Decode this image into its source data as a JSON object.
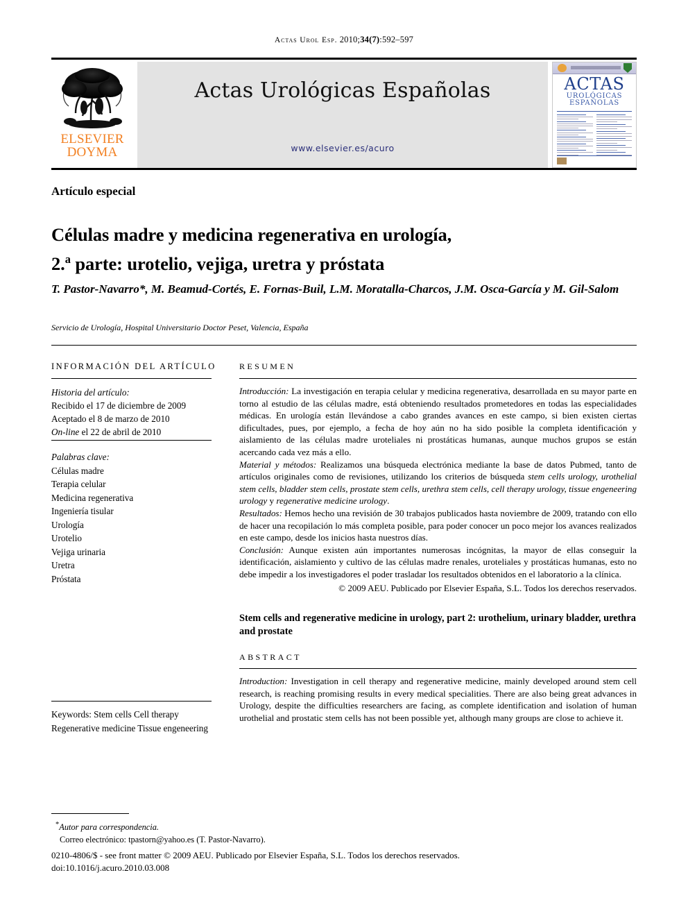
{
  "running_head": {
    "journal_abbrev": "Actas Urol Esp.",
    "citation": "2010;",
    "volume_issue": "34(7)",
    "pages": ":592–597"
  },
  "masthead": {
    "publisher_line1": "ELSEVIER",
    "publisher_line2": "DOYMA",
    "journal_title": "Actas Urológicas Españolas",
    "journal_url": "www.elsevier.es/acuro",
    "cover": {
      "title": "ACTAS",
      "subtitle_line1": "UROLÓGICAS",
      "subtitle_line2": "ESPAÑOLAS"
    }
  },
  "article": {
    "section_type": "Artículo especial",
    "title_line1": "Células madre y medicina regenerativa en urología,",
    "title_line2_prefix": "2.",
    "title_line2_sup": "a",
    "title_line2_rest": " parte: urotelio, vejiga, uretra y próstata",
    "authors": "T. Pastor-Navarro*, M. Beamud-Cortés, E. Fornas-Buil, L.M. Moratalla-Charcos, J.M. Osca-García y M. Gil-Salom",
    "affiliation": "Servicio de Urología, Hospital Universitario Doctor Peset, Valencia, España"
  },
  "info_column": {
    "heading": "INFORMACIÓN DEL ARTÍCULO",
    "history_label": "Historia del artículo:",
    "history": [
      "Recibido el 17 de diciembre de 2009",
      "Aceptado el 8 de marzo de 2010"
    ],
    "online_italic": "On-line",
    "online_rest": " el 22 de abril de 2010",
    "keywords_label": "Palabras clave:",
    "keywords": [
      "Células madre",
      "Terapia celular",
      "Medicina regenerativa",
      "Ingeniería tisular",
      "Urología",
      "Urotelio",
      "Vejiga urinaria",
      "Uretra",
      "Próstata"
    ],
    "keywords_en_label": "Keywords:",
    "keywords_en": [
      "Stem cells",
      "Cell therapy",
      "Regenerative medicine",
      "Tissue engeneering"
    ]
  },
  "abstract_es": {
    "heading": "RESUMEN",
    "intro_label": "Introducción:",
    "intro_text": " La investigación en terapia celular y medicina regenerativa, desarrollada en su mayor parte en torno al estudio de las células madre, está obteniendo resultados prometedores en todas las especialidades médicas. En urología están llevándose a cabo grandes avances en este campo, si bien existen ciertas dificultades, pues, por ejemplo, a fecha de hoy aún no ha sido posible la completa identificación y aislamiento de las células madre uroteliales ni prostáticas humanas, aunque muchos grupos se están acercando cada vez más a ello.",
    "methods_label": "Material y métodos:",
    "methods_text_1": " Realizamos una búsqueda electrónica mediante la base de datos Pubmed, tanto de artículos originales como de revisiones, utilizando los criterios de búsqueda ",
    "methods_terms": "stem cells urology, urothelial stem cells, bladder stem cells, prostate stem cells, urethra stem cells, cell therapy urology, tissue engeneering urology",
    "methods_text_2": " y ",
    "methods_terms_2": "regenerative medicine urology",
    "methods_text_3": ".",
    "results_label": "Resultados:",
    "results_text": " Hemos hecho una revisión de 30 trabajos publicados hasta noviembre de 2009, tratando con ello de hacer una recopilación lo más completa posible, para poder conocer un poco mejor los avances realizados en este campo, desde los inicios hasta nuestros días.",
    "conclusion_label": "Conclusión:",
    "conclusion_text": " Aunque existen aún importantes numerosas incógnitas, la mayor de ellas conseguir la identificación, aislamiento y cultivo de las células madre renales, uroteliales y prostáticas humanas, esto no debe impedir a los investigadores el poder trasladar los resultados obtenidos en el laboratorio a la clínica.",
    "copyright": "© 2009 AEU. Publicado por Elsevier España, S.L. Todos los derechos reservados."
  },
  "abstract_en": {
    "title": "Stem cells and regenerative medicine in urology, part 2: urothelium, urinary bladder, urethra and prostate",
    "heading": "ABSTRACT",
    "intro_label": "Introduction:",
    "intro_text": " Investigation in cell therapy and regenerative medicine, mainly developed around stem cell research, is reaching promising results in every medical specialities. There are also being great advances in Urology, despite the difficulties researchers are facing, as complete identification and isolation of human urothelial and prostatic stem cells has not been possible yet, although many groups are close to achieve it."
  },
  "footnotes": {
    "corresponding": "Autor para correspondencia.",
    "email_line": "Correo electrónico: tpastorn@yahoo.es (T. Pastor-Navarro).",
    "frontmatter_line1": "0210-4806/$ - see front matter © 2009 AEU. Publicado por Elsevier España, S.L. Todos los derechos reservados.",
    "frontmatter_line2": "doi:10.1016/j.acuro.2010.03.008"
  },
  "colors": {
    "elsevier_orange": "#F28022",
    "band_gray": "#e3e3e3",
    "url_blue": "#2b2f7a",
    "cover_blue": "#20408c"
  }
}
